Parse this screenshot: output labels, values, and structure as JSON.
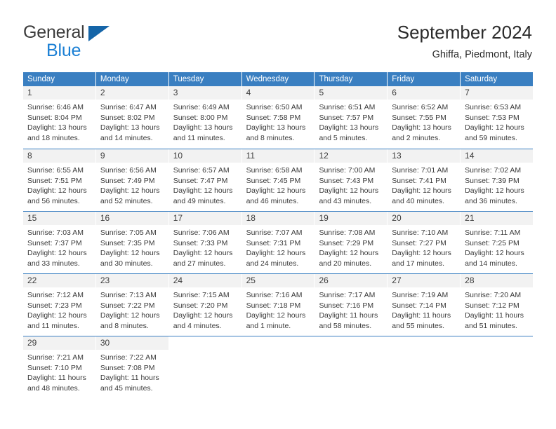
{
  "brand": {
    "name_top": "General",
    "name_bottom": "Blue",
    "triangle_color": "#1565a8",
    "bottom_color": "#1a7fd4"
  },
  "header": {
    "title": "September 2024",
    "subtitle": "Ghiffa, Piedmont, Italy"
  },
  "theme": {
    "header_blue": "#3a7fc1",
    "daynum_band": "#f2f2f2",
    "text": "#3a3a3a"
  },
  "weekdays": [
    "Sunday",
    "Monday",
    "Tuesday",
    "Wednesday",
    "Thursday",
    "Friday",
    "Saturday"
  ],
  "weeks": [
    [
      {
        "day": "1",
        "sunrise": "Sunrise: 6:46 AM",
        "sunset": "Sunset: 8:04 PM",
        "daylight1": "Daylight: 13 hours",
        "daylight2": "and 18 minutes."
      },
      {
        "day": "2",
        "sunrise": "Sunrise: 6:47 AM",
        "sunset": "Sunset: 8:02 PM",
        "daylight1": "Daylight: 13 hours",
        "daylight2": "and 14 minutes."
      },
      {
        "day": "3",
        "sunrise": "Sunrise: 6:49 AM",
        "sunset": "Sunset: 8:00 PM",
        "daylight1": "Daylight: 13 hours",
        "daylight2": "and 11 minutes."
      },
      {
        "day": "4",
        "sunrise": "Sunrise: 6:50 AM",
        "sunset": "Sunset: 7:58 PM",
        "daylight1": "Daylight: 13 hours",
        "daylight2": "and 8 minutes."
      },
      {
        "day": "5",
        "sunrise": "Sunrise: 6:51 AM",
        "sunset": "Sunset: 7:57 PM",
        "daylight1": "Daylight: 13 hours",
        "daylight2": "and 5 minutes."
      },
      {
        "day": "6",
        "sunrise": "Sunrise: 6:52 AM",
        "sunset": "Sunset: 7:55 PM",
        "daylight1": "Daylight: 13 hours",
        "daylight2": "and 2 minutes."
      },
      {
        "day": "7",
        "sunrise": "Sunrise: 6:53 AM",
        "sunset": "Sunset: 7:53 PM",
        "daylight1": "Daylight: 12 hours",
        "daylight2": "and 59 minutes."
      }
    ],
    [
      {
        "day": "8",
        "sunrise": "Sunrise: 6:55 AM",
        "sunset": "Sunset: 7:51 PM",
        "daylight1": "Daylight: 12 hours",
        "daylight2": "and 56 minutes."
      },
      {
        "day": "9",
        "sunrise": "Sunrise: 6:56 AM",
        "sunset": "Sunset: 7:49 PM",
        "daylight1": "Daylight: 12 hours",
        "daylight2": "and 52 minutes."
      },
      {
        "day": "10",
        "sunrise": "Sunrise: 6:57 AM",
        "sunset": "Sunset: 7:47 PM",
        "daylight1": "Daylight: 12 hours",
        "daylight2": "and 49 minutes."
      },
      {
        "day": "11",
        "sunrise": "Sunrise: 6:58 AM",
        "sunset": "Sunset: 7:45 PM",
        "daylight1": "Daylight: 12 hours",
        "daylight2": "and 46 minutes."
      },
      {
        "day": "12",
        "sunrise": "Sunrise: 7:00 AM",
        "sunset": "Sunset: 7:43 PM",
        "daylight1": "Daylight: 12 hours",
        "daylight2": "and 43 minutes."
      },
      {
        "day": "13",
        "sunrise": "Sunrise: 7:01 AM",
        "sunset": "Sunset: 7:41 PM",
        "daylight1": "Daylight: 12 hours",
        "daylight2": "and 40 minutes."
      },
      {
        "day": "14",
        "sunrise": "Sunrise: 7:02 AM",
        "sunset": "Sunset: 7:39 PM",
        "daylight1": "Daylight: 12 hours",
        "daylight2": "and 36 minutes."
      }
    ],
    [
      {
        "day": "15",
        "sunrise": "Sunrise: 7:03 AM",
        "sunset": "Sunset: 7:37 PM",
        "daylight1": "Daylight: 12 hours",
        "daylight2": "and 33 minutes."
      },
      {
        "day": "16",
        "sunrise": "Sunrise: 7:05 AM",
        "sunset": "Sunset: 7:35 PM",
        "daylight1": "Daylight: 12 hours",
        "daylight2": "and 30 minutes."
      },
      {
        "day": "17",
        "sunrise": "Sunrise: 7:06 AM",
        "sunset": "Sunset: 7:33 PM",
        "daylight1": "Daylight: 12 hours",
        "daylight2": "and 27 minutes."
      },
      {
        "day": "18",
        "sunrise": "Sunrise: 7:07 AM",
        "sunset": "Sunset: 7:31 PM",
        "daylight1": "Daylight: 12 hours",
        "daylight2": "and 24 minutes."
      },
      {
        "day": "19",
        "sunrise": "Sunrise: 7:08 AM",
        "sunset": "Sunset: 7:29 PM",
        "daylight1": "Daylight: 12 hours",
        "daylight2": "and 20 minutes."
      },
      {
        "day": "20",
        "sunrise": "Sunrise: 7:10 AM",
        "sunset": "Sunset: 7:27 PM",
        "daylight1": "Daylight: 12 hours",
        "daylight2": "and 17 minutes."
      },
      {
        "day": "21",
        "sunrise": "Sunrise: 7:11 AM",
        "sunset": "Sunset: 7:25 PM",
        "daylight1": "Daylight: 12 hours",
        "daylight2": "and 14 minutes."
      }
    ],
    [
      {
        "day": "22",
        "sunrise": "Sunrise: 7:12 AM",
        "sunset": "Sunset: 7:23 PM",
        "daylight1": "Daylight: 12 hours",
        "daylight2": "and 11 minutes."
      },
      {
        "day": "23",
        "sunrise": "Sunrise: 7:13 AM",
        "sunset": "Sunset: 7:22 PM",
        "daylight1": "Daylight: 12 hours",
        "daylight2": "and 8 minutes."
      },
      {
        "day": "24",
        "sunrise": "Sunrise: 7:15 AM",
        "sunset": "Sunset: 7:20 PM",
        "daylight1": "Daylight: 12 hours",
        "daylight2": "and 4 minutes."
      },
      {
        "day": "25",
        "sunrise": "Sunrise: 7:16 AM",
        "sunset": "Sunset: 7:18 PM",
        "daylight1": "Daylight: 12 hours",
        "daylight2": "and 1 minute."
      },
      {
        "day": "26",
        "sunrise": "Sunrise: 7:17 AM",
        "sunset": "Sunset: 7:16 PM",
        "daylight1": "Daylight: 11 hours",
        "daylight2": "and 58 minutes."
      },
      {
        "day": "27",
        "sunrise": "Sunrise: 7:19 AM",
        "sunset": "Sunset: 7:14 PM",
        "daylight1": "Daylight: 11 hours",
        "daylight2": "and 55 minutes."
      },
      {
        "day": "28",
        "sunrise": "Sunrise: 7:20 AM",
        "sunset": "Sunset: 7:12 PM",
        "daylight1": "Daylight: 11 hours",
        "daylight2": "and 51 minutes."
      }
    ],
    [
      {
        "day": "29",
        "sunrise": "Sunrise: 7:21 AM",
        "sunset": "Sunset: 7:10 PM",
        "daylight1": "Daylight: 11 hours",
        "daylight2": "and 48 minutes."
      },
      {
        "day": "30",
        "sunrise": "Sunrise: 7:22 AM",
        "sunset": "Sunset: 7:08 PM",
        "daylight1": "Daylight: 11 hours",
        "daylight2": "and 45 minutes."
      },
      null,
      null,
      null,
      null,
      null
    ]
  ]
}
